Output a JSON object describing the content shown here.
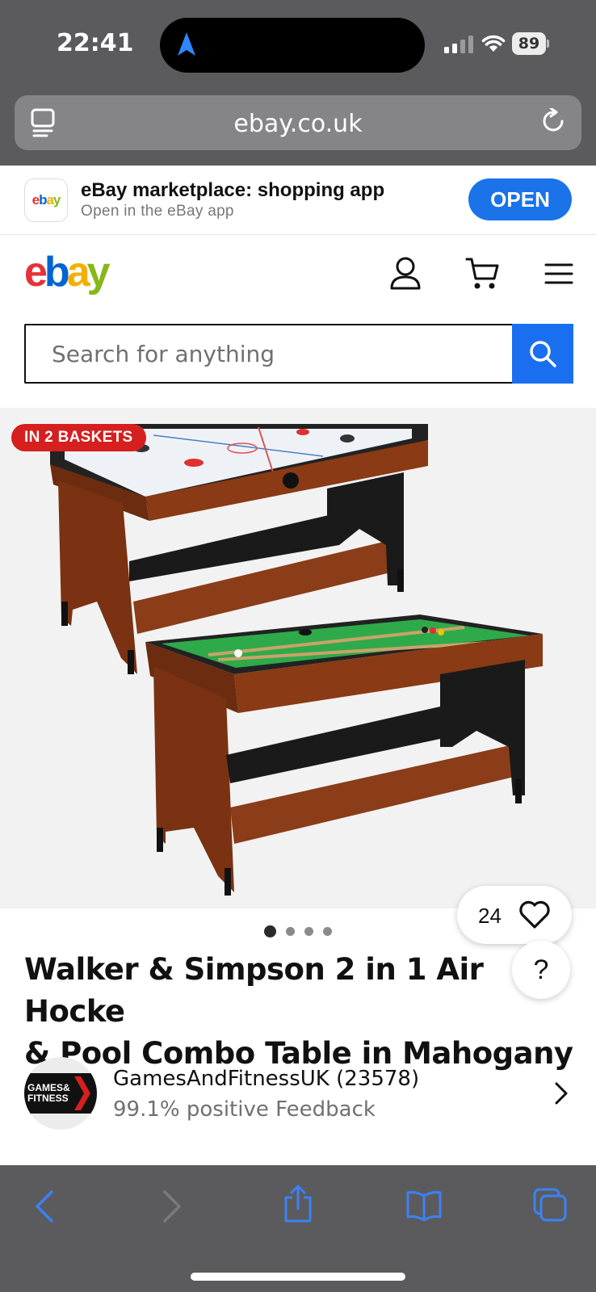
{
  "status": {
    "time": "22:41",
    "battery": "89"
  },
  "browser": {
    "url": "ebay.co.uk"
  },
  "app_banner": {
    "icon_text": "ebay",
    "title": "eBay marketplace: shopping app",
    "subtitle": "Open in the eBay app",
    "open_label": "OPEN"
  },
  "header": {
    "logo": {
      "e": "e",
      "b": "b",
      "a": "a",
      "y": "y"
    }
  },
  "search": {
    "placeholder": "Search for anything"
  },
  "gallery": {
    "badge": "IN 2 BASKETS",
    "watch_count": "24",
    "image_count": 4,
    "active_index": 0
  },
  "help_label": "?",
  "listing": {
    "title_line1": "Walker & Simpson 2 in 1 Air Hocke",
    "title_line2": "& Pool Combo Table in Mahogany"
  },
  "seller": {
    "avatar_line1": "GAMES&",
    "avatar_line2": "FITNESS",
    "name": "GamesAndFitnessUK (23578)",
    "feedback": "99.1% positive Feedback"
  },
  "colors": {
    "ebay_red": "#e53238",
    "ebay_blue": "#0064d2",
    "ebay_yellow": "#f5af02",
    "ebay_green": "#86b817",
    "accent_blue": "#1a6ff0",
    "badge_red": "#d61f1f"
  },
  "icons": {
    "status": [
      "location-arrow-icon",
      "signal-icon",
      "wifi-icon",
      "battery-icon"
    ],
    "header": [
      "user-icon",
      "cart-icon",
      "menu-icon"
    ],
    "toolbar": [
      "back-icon",
      "forward-icon",
      "share-icon",
      "bookmarks-icon",
      "tabs-icon"
    ]
  }
}
